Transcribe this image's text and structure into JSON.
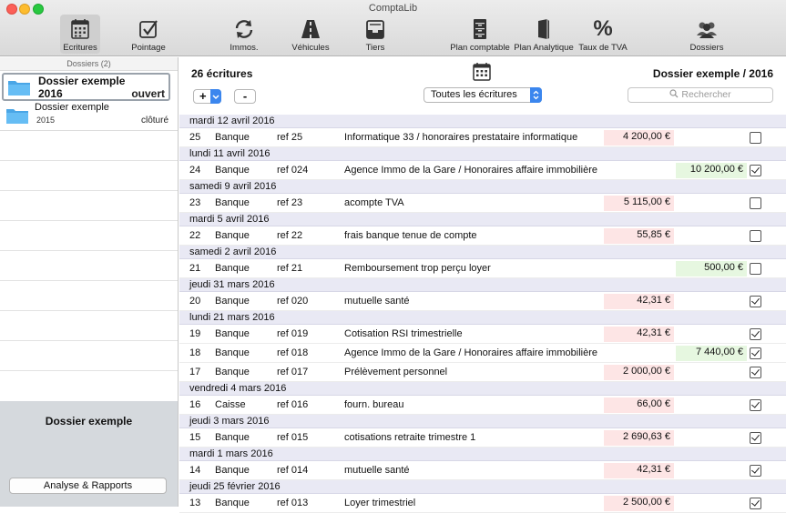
{
  "window": {
    "title": "ComptaLib"
  },
  "toolbar": [
    {
      "id": "ecritures",
      "label": "Ecritures",
      "icon": "calendar-icon",
      "active": true
    },
    {
      "id": "pointage",
      "label": "Pointage",
      "icon": "checkbox-icon"
    },
    {
      "id": "immos",
      "label": "Immos.",
      "icon": "refresh-icon"
    },
    {
      "id": "vehicules",
      "label": "Véhicules",
      "icon": "road-icon"
    },
    {
      "id": "tiers",
      "label": "Tiers",
      "icon": "tray-icon"
    },
    {
      "id": "plan-comptable",
      "label": "Plan comptable",
      "icon": "cabinet-icon"
    },
    {
      "id": "plan-analytique",
      "label": "Plan Analytique",
      "icon": "book-icon"
    },
    {
      "id": "tva",
      "label": "Taux de TVA",
      "icon": "percent-icon",
      "glyph": "%"
    },
    {
      "id": "dossiers",
      "label": "Dossiers",
      "icon": "people-icon"
    }
  ],
  "sidebar": {
    "header": "Dossiers (2)",
    "dossiers": [
      {
        "name": "Dossier exemple",
        "year": "2016",
        "status": "ouvert",
        "selected": true
      },
      {
        "name": "Dossier exemple",
        "year": "2015",
        "status": "clôturé",
        "selected": false
      }
    ],
    "footer_title": "Dossier exemple",
    "analyse_button": "Analyse & Rapports"
  },
  "main": {
    "count_label": "26 écritures",
    "dossier_title": "Dossier exemple / 2016",
    "add_label": "+",
    "remove_label": "-",
    "filter_value": "Toutes les écritures",
    "search_placeholder": "Rechercher",
    "accent": "#3b86ee",
    "debit_color": "#fde5e5",
    "credit_color": "#e6f7e0"
  },
  "groups": [
    {
      "date": "mardi 12 avril 2016",
      "entries": [
        {
          "num": "25",
          "journal": "Banque",
          "ref": "ref 25",
          "libelle": "Informatique 33 / honoraires prestataire informatique",
          "debit": "4 200,00 €",
          "credit": "",
          "checked": false
        }
      ]
    },
    {
      "date": "lundi 11 avril 2016",
      "entries": [
        {
          "num": "24",
          "journal": "Banque",
          "ref": "ref 024",
          "libelle": "Agence Immo de la Gare / Honoraires affaire immobilière",
          "debit": "",
          "credit": "10 200,00 €",
          "checked": true
        }
      ]
    },
    {
      "date": "samedi 9 avril 2016",
      "entries": [
        {
          "num": "23",
          "journal": "Banque",
          "ref": "ref 23",
          "libelle": "acompte TVA",
          "debit": "5 115,00 €",
          "credit": "",
          "checked": false
        }
      ]
    },
    {
      "date": "mardi 5 avril 2016",
      "entries": [
        {
          "num": "22",
          "journal": "Banque",
          "ref": "ref 22",
          "libelle": "frais banque tenue de compte",
          "debit": "55,85 €",
          "credit": "",
          "checked": false
        }
      ]
    },
    {
      "date": "samedi 2 avril 2016",
      "entries": [
        {
          "num": "21",
          "journal": "Banque",
          "ref": "ref 21",
          "libelle": "Remboursement trop perçu loyer",
          "debit": "",
          "credit": "500,00 €",
          "checked": false
        }
      ]
    },
    {
      "date": "jeudi 31 mars 2016",
      "entries": [
        {
          "num": "20",
          "journal": "Banque",
          "ref": "ref 020",
          "libelle": "mutuelle santé",
          "debit": "42,31 €",
          "credit": "",
          "checked": true
        }
      ]
    },
    {
      "date": "lundi 21 mars 2016",
      "entries": [
        {
          "num": "19",
          "journal": "Banque",
          "ref": "ref 019",
          "libelle": "Cotisation RSI trimestrielle",
          "debit": "42,31 €",
          "credit": "",
          "checked": true
        },
        {
          "num": "18",
          "journal": "Banque",
          "ref": "ref 018",
          "libelle": "Agence Immo de la Gare / Honoraires affaire immobilière",
          "debit": "",
          "credit": "7 440,00 €",
          "checked": true
        },
        {
          "num": "17",
          "journal": "Banque",
          "ref": "ref 017",
          "libelle": "Prélèvement personnel",
          "debit": "2 000,00 €",
          "credit": "",
          "checked": true
        }
      ]
    },
    {
      "date": "vendredi 4 mars 2016",
      "entries": [
        {
          "num": "16",
          "journal": "Caisse",
          "ref": "ref 016",
          "libelle": "fourn. bureau",
          "debit": "66,00 €",
          "credit": "",
          "checked": true
        }
      ]
    },
    {
      "date": "jeudi 3 mars 2016",
      "entries": [
        {
          "num": "15",
          "journal": "Banque",
          "ref": "ref 015",
          "libelle": "cotisations retraite trimestre 1",
          "debit": "2 690,63 €",
          "credit": "",
          "checked": true
        }
      ]
    },
    {
      "date": "mardi 1 mars 2016",
      "entries": [
        {
          "num": "14",
          "journal": "Banque",
          "ref": "ref 014",
          "libelle": "mutuelle santé",
          "debit": "42,31 €",
          "credit": "",
          "checked": true
        }
      ]
    },
    {
      "date": "jeudi 25 février 2016",
      "entries": [
        {
          "num": "13",
          "journal": "Banque",
          "ref": "ref 013",
          "libelle": "Loyer trimestriel",
          "debit": "2 500,00 €",
          "credit": "",
          "checked": true
        }
      ]
    }
  ]
}
